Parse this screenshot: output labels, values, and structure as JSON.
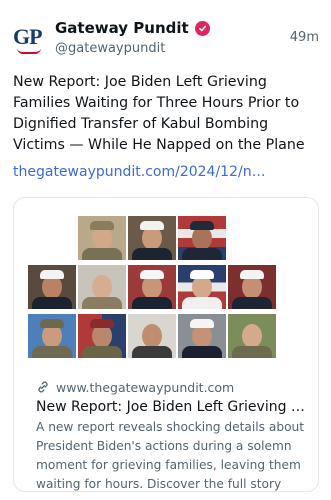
{
  "author": {
    "logo_text": "GP",
    "name": "Gateway Pundit",
    "handle": "@gatewaypundit",
    "badge_color": "#e0245e"
  },
  "post": {
    "time": "49m",
    "text": "New Report: Joe Biden Left Grieving Families Waiting for Three Hours Prior to Dignified Transfer of Kabul Bombing Victims — While He Napped on the Plane",
    "link": "thegatewaypundit.com/2024/12/n…"
  },
  "card": {
    "domain": "www.thegatewaypundit.com",
    "title": "New Report: Joe Biden Left Grieving …",
    "description": "A new report reveals shocking details about President Biden's actions during a solemn moment for grieving families, leaving them waiting for hours. Discover the full story beh…",
    "link_icon": "link-icon"
  },
  "colors": {
    "link": "#3b6bd6",
    "secondary_text": "#536471",
    "logo": "#1a3a6e"
  }
}
